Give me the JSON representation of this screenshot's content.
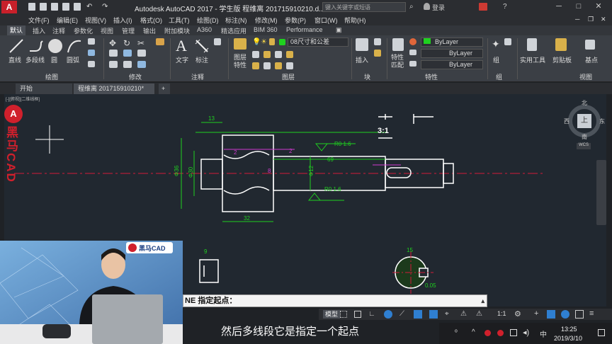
{
  "app": {
    "title": "Autodesk AutoCAD 2017 - 学生版    程维离 201715910210.d...",
    "search_placeholder": "键入关键字或短语",
    "login": "登录"
  },
  "menu": [
    "文件(F)",
    "编辑(E)",
    "视图(V)",
    "插入(I)",
    "格式(O)",
    "工具(T)",
    "绘图(D)",
    "标注(N)",
    "修改(M)",
    "参数(P)",
    "窗口(W)",
    "帮助(H)"
  ],
  "ribbon_tabs": [
    "默认",
    "插入",
    "注释",
    "参数化",
    "视图",
    "管理",
    "输出",
    "附加模块",
    "A360",
    "精选应用",
    "BIM 360",
    "Performance"
  ],
  "ribbon": {
    "draw_tools": [
      "直线",
      "多段线",
      "圆",
      "圆弧"
    ],
    "text_tools": [
      "文字",
      "标注"
    ],
    "layer_props": "图层\n特性",
    "layer_combo": "08尺寸和公差",
    "insert": "插入",
    "match_props": "特性\n匹配",
    "bylayer1": "ByLayer",
    "bylayer2": "ByLayer",
    "bylayer3": "ByLayer",
    "group": "组",
    "utilities": "实用工具",
    "clipboard": "剪贴板",
    "base": "基点",
    "panels": [
      "绘图",
      "修改",
      "注释",
      "图层",
      "块",
      "特性",
      "组",
      "视图"
    ]
  },
  "doc_tabs": [
    "开始",
    "程维离 201715910210*"
  ],
  "viewport_label": "[-][俯视][二维线框]",
  "viewcube": {
    "north": "北",
    "south": "南",
    "east": "东",
    "west": "西",
    "top": "上",
    "wcs": "WCS"
  },
  "drawing_annotations": {
    "d13": "13",
    "d2a": "2",
    "d2b": "2",
    "r16a": "R0 1.6",
    "r16b": "R0 1.6",
    "d69": "69",
    "d32": "32",
    "d8": "8",
    "phi12": "Φ12",
    "phi30": "Φ30",
    "phi36": "Φ36",
    "scale": "3:1",
    "d9": "9",
    "d15": "15",
    "d005": "0.05"
  },
  "command_line": "NE 指定起点：",
  "status": {
    "model": "模型",
    "scale": "1:1"
  },
  "subtitle": "然后多线段它是指定一个起点",
  "clock": {
    "time": "13:25",
    "date": "2019/3/10"
  },
  "ime": "中",
  "brand": {
    "vertical": "黑马CAD",
    "card": "黑马CAD"
  },
  "colors": {
    "accent": "#2f7fd1",
    "drawing_line": "#ffffff",
    "dim_line": "#1fd11f",
    "center_line": "#d21a3a",
    "autocad_red": "#d0202c"
  }
}
